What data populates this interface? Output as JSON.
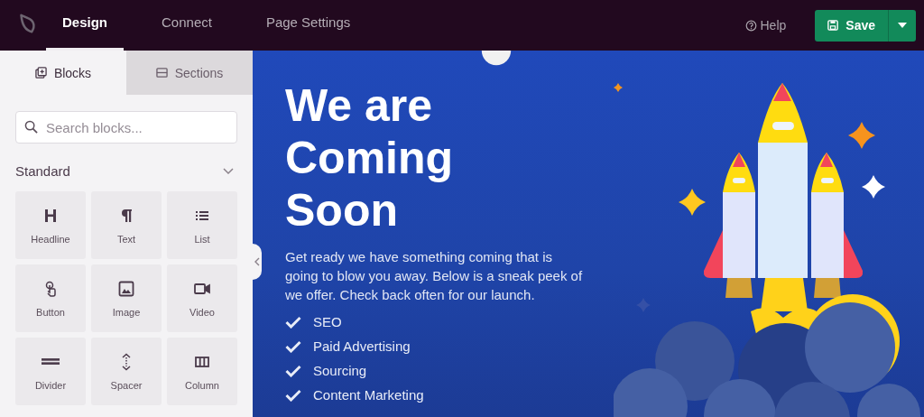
{
  "top_bar": {
    "nav_tabs": [
      {
        "label": "Design",
        "selected": true
      },
      {
        "label": "Connect",
        "selected": false
      },
      {
        "label": "Page Settings",
        "selected": false
      }
    ],
    "help": "Help",
    "save_button": "Save"
  },
  "sidebar": {
    "tabs": [
      {
        "label": "Blocks",
        "kind": "blocks",
        "selected": true
      },
      {
        "label": "Sections",
        "kind": "sections",
        "selected": false
      }
    ],
    "search": {
      "placeholder": "Search blocks..."
    },
    "section": {
      "title": "Standard",
      "expanded": true
    },
    "blocks": [
      {
        "label": "Headline",
        "kind": "headline"
      },
      {
        "label": "Text",
        "kind": "text"
      },
      {
        "label": "List",
        "kind": "list"
      },
      {
        "label": "Button",
        "kind": "button"
      },
      {
        "label": "Image",
        "kind": "image"
      },
      {
        "label": "Video",
        "kind": "video"
      },
      {
        "label": "Divider",
        "kind": "divider"
      },
      {
        "label": "Spacer",
        "kind": "spacer"
      },
      {
        "label": "Column",
        "kind": "column"
      }
    ]
  },
  "canvas": {
    "headline": [
      "We are",
      "Coming",
      "Soon"
    ],
    "paragraph": "Get ready we have something coming that is going to blow you away. Below is a sneak peek of we offer. Check back often for our launch.",
    "checklist": [
      "SEO",
      "Paid Advertising",
      "Sourcing",
      "Content Marketing"
    ]
  }
}
